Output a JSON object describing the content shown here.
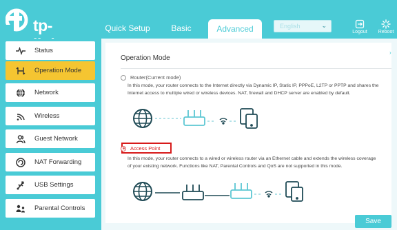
{
  "brand": {
    "name": "tp-link",
    "color": "#4acbd6"
  },
  "tabs": {
    "quick_setup": "Quick Setup",
    "basic": "Basic",
    "advanced": "Advanced"
  },
  "language": {
    "selected": "English"
  },
  "header_buttons": {
    "logout": "Logout",
    "reboot": "Reboot"
  },
  "sidebar": {
    "items": [
      {
        "label": "Status",
        "icon": "pulse-icon"
      },
      {
        "label": "Operation Mode",
        "icon": "swap-arrows-icon",
        "active": true
      },
      {
        "label": "Network",
        "icon": "globe-icon"
      },
      {
        "label": "Wireless",
        "icon": "wifi-icon"
      },
      {
        "label": "Guest Network",
        "icon": "users-icon"
      },
      {
        "label": "NAT Forwarding",
        "icon": "nat-icon"
      },
      {
        "label": "USB Settings",
        "icon": "usb-icon"
      },
      {
        "label": "Parental Controls",
        "icon": "parental-icon"
      }
    ],
    "active_color": "#f5c531"
  },
  "main": {
    "title": "Operation Mode",
    "options": [
      {
        "label": "Router(Current mode)",
        "selected": false,
        "description_line1": "In this mode, your router connects to the Internet directly via Dynamic IP, Static IP, PPPoE, L2TP or PPTP and shares the",
        "description_line2": "Internet access to multiple wired or wireless devices. NAT, firewall and DHCP server are enabled by default."
      },
      {
        "label": "Access Point",
        "selected": true,
        "description_line1": "In this mode, your router connects to a wired or wireless router via an Ethernet cable and extends the wireless coverage",
        "description_line2": "of your existing network. Functions like NAT, Parental Controls and QoS are not supported in this mode."
      }
    ],
    "highlight_color": "#d71a1a"
  },
  "save_button": "Save"
}
